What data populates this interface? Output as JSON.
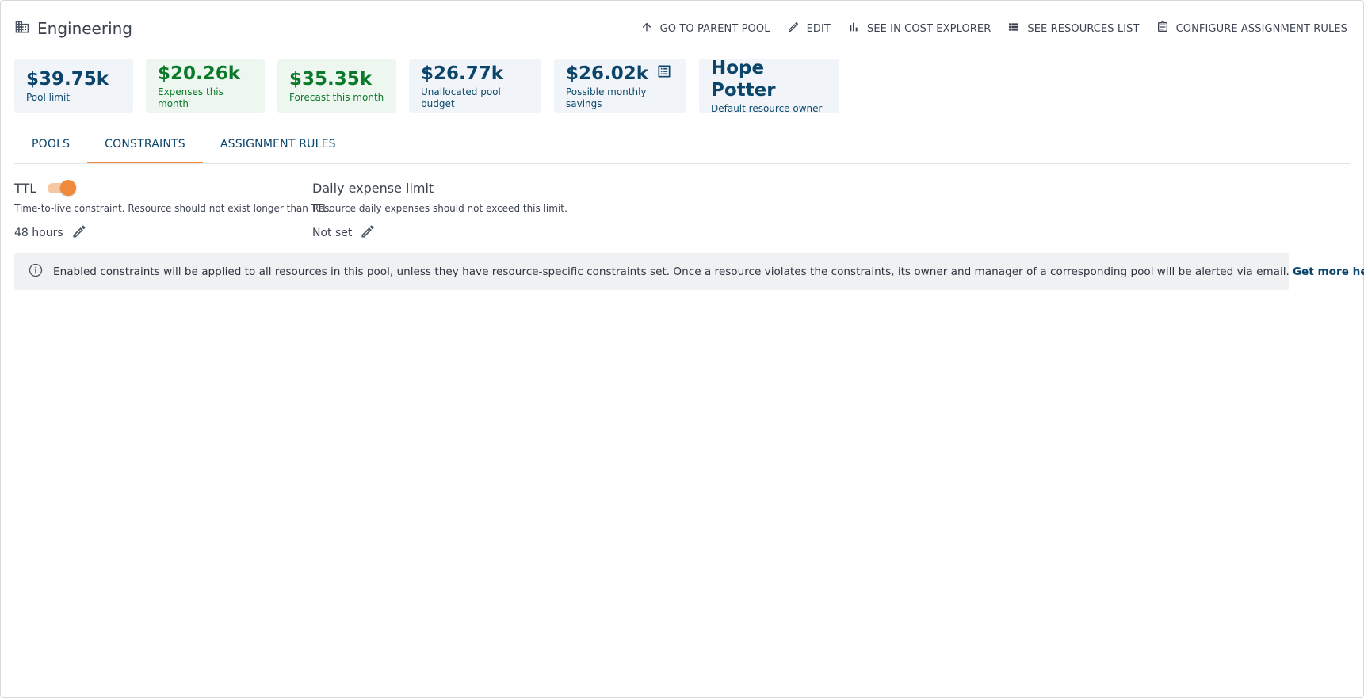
{
  "header": {
    "title": "Engineering",
    "title_icon": "building-icon",
    "actions": [
      {
        "label": "GO TO PARENT POOL",
        "icon": "arrow-up-icon"
      },
      {
        "label": "EDIT",
        "icon": "pencil-icon"
      },
      {
        "label": "SEE IN COST EXPLORER",
        "icon": "bar-chart-icon"
      },
      {
        "label": "SEE RESOURCES LIST",
        "icon": "list-icon"
      },
      {
        "label": "CONFIGURE ASSIGNMENT RULES",
        "icon": "clipboard-icon"
      }
    ]
  },
  "cards": [
    {
      "value": "$39.75k",
      "label": "Pool limit",
      "tone": "blue"
    },
    {
      "value": "$20.26k",
      "label": "Expenses this month",
      "tone": "green"
    },
    {
      "value": "$35.35k",
      "label": "Forecast this month",
      "tone": "green"
    },
    {
      "value": "$26.77k",
      "label": "Unallocated pool budget",
      "tone": "blue"
    },
    {
      "value": "$26.02k",
      "label": "Possible monthly savings",
      "tone": "blue",
      "icon": "details-list-icon"
    },
    {
      "value": "Hope Potter",
      "label": "Default resource owner",
      "tone": "blue"
    }
  ],
  "tabs": [
    {
      "label": "POOLS",
      "active": false
    },
    {
      "label": "CONSTRAINTS",
      "active": true
    },
    {
      "label": "ASSIGNMENT RULES",
      "active": false
    }
  ],
  "constraints": {
    "ttl": {
      "title": "TTL",
      "enabled": true,
      "description": "Time-to-live constraint. Resource should not exist longer than TTL.",
      "value": "48 hours"
    },
    "daily": {
      "title": "Daily expense limit",
      "description": "Resource daily expenses should not exceed this limit.",
      "value": "Not set"
    }
  },
  "banner": {
    "text": "Enabled constraints will be applied to all resources in this pool, unless they have resource-specific constraints set. Once a resource violates the constraints, its owner and manager of a corresponding pool will be alerted via email.",
    "link": "Get more help"
  },
  "colors": {
    "accent": "#f08a3a",
    "primary": "#0b456b",
    "success": "#0a7a2a"
  }
}
